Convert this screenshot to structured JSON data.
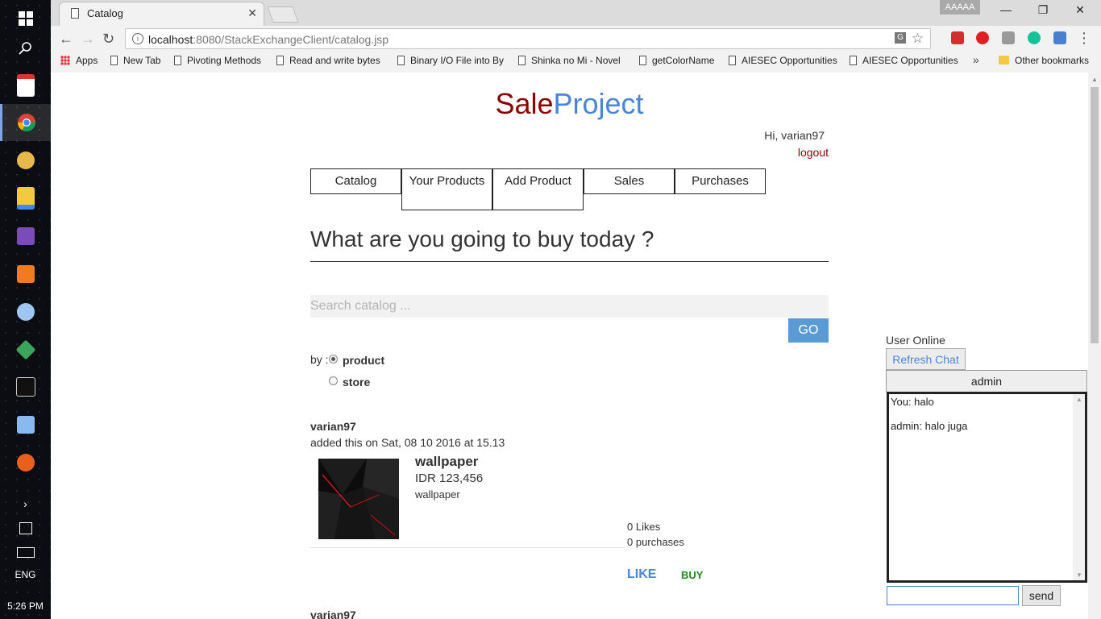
{
  "browser": {
    "tab_title": "Catalog",
    "profile_label": "AAAAA",
    "url_host": "localhost",
    "url_path": ":8080/StackExchangeClient/catalog.jsp",
    "bookmarks": [
      "Apps",
      "New Tab",
      "Pivoting Methods",
      "Read and write bytes",
      "Binary I/O File into By",
      "Shinka no Mi - Novel",
      "getColorName",
      "AIESEC Opportunities",
      "AIESEC Opportunities"
    ],
    "bookmarks_more": "»",
    "other_bookmarks": "Other bookmarks"
  },
  "taskbar": {
    "language": "ENG",
    "time": "5:26 PM",
    "app_icons": [
      "start-windows-icon",
      "search-icon",
      "calendar-app-icon",
      "chrome-icon",
      "app-icon",
      "file-explorer-icon",
      "visual-studio-icon",
      "xampp-icon",
      "paint-icon",
      "git-icon",
      "terminal-icon",
      "virtualbox-icon",
      "firefox-icon"
    ]
  },
  "page": {
    "logo_part1": "Sale",
    "logo_part2": "Project",
    "greeting": "Hi, varian97",
    "logout": "logout",
    "nav": [
      {
        "label": "Catalog"
      },
      {
        "label": "Your Products"
      },
      {
        "label": "Add Product"
      },
      {
        "label": "Sales"
      },
      {
        "label": "Purchases"
      }
    ],
    "heading": "What are you going to buy today ?",
    "search_placeholder": "Search catalog ...",
    "go_label": "GO",
    "by_label": "by :",
    "filter_options": [
      {
        "label": "product",
        "checked": true
      },
      {
        "label": "store",
        "checked": false
      }
    ],
    "posts": [
      {
        "user": "varian97",
        "date": "added this on Sat, 08 10 2016 at 15.13",
        "product_name": "wallpaper",
        "price": "IDR 123,456",
        "description": "wallpaper",
        "likes": "0 Likes",
        "purchases": "0 purchases",
        "like_label": "LIKE",
        "buy_label": "BUY"
      },
      {
        "user": "varian97"
      }
    ]
  },
  "chat": {
    "online_label": "User Online",
    "refresh_label": "Refresh Chat",
    "active_user": "admin",
    "messages": [
      "You: halo",
      "admin: halo juga"
    ],
    "input_value": "",
    "send_label": "send"
  },
  "colors": {
    "logo_sale": "#8b0000",
    "logo_project": "#4a86d8",
    "go_button": "#5b9bd5",
    "like": "#4a86d8",
    "buy": "#1a8a1a"
  }
}
